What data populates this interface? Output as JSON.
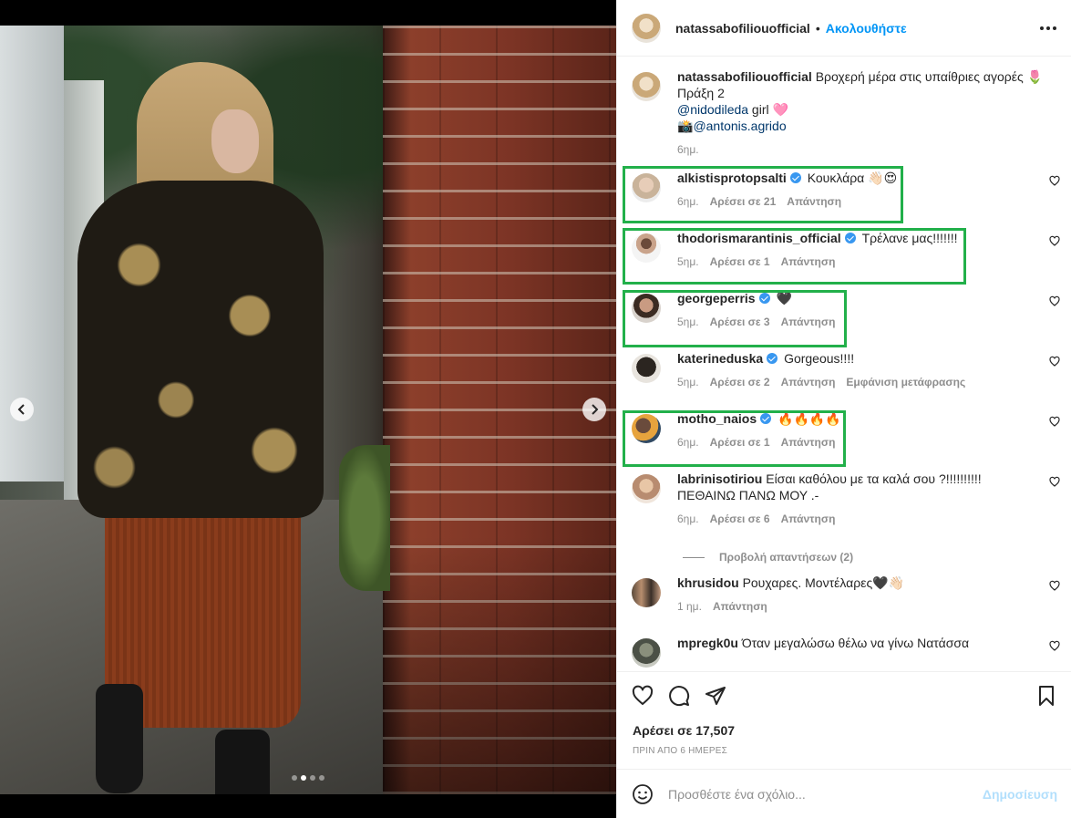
{
  "header": {
    "username": "natassabofiliouofficial",
    "bullet": "•",
    "follow_label": "Ακολουθήστε",
    "more_icon": "more-horizontal-icon"
  },
  "caption": {
    "username": "natassabofiliouofficial",
    "text": "Βροχερή μέρα στις υπαίθριες αγορές 🌷",
    "line2": "Πράξη 2",
    "mention1": "@nidodileda",
    "mention1_suffix": " girl 🩷",
    "mention2_prefix": "📸",
    "mention2": "@antonis.agrido",
    "time": "6ημ."
  },
  "comments": [
    {
      "username": "alkistisprotopsalti",
      "verified": true,
      "text": "Κουκλάρα 👋🏻😍",
      "time": "6ημ.",
      "likes": "Αρέσει σε 21",
      "reply": "Απάντηση",
      "highlighted": true
    },
    {
      "username": "thodorismarantinis_official",
      "verified": true,
      "text": "Τρέλανε μας!!!!!!!",
      "time": "5ημ.",
      "likes": "Αρέσει σε 1",
      "reply": "Απάντηση",
      "highlighted": true
    },
    {
      "username": "georgeperris",
      "verified": true,
      "text": "🖤",
      "time": "5ημ.",
      "likes": "Αρέσει σε 3",
      "reply": "Απάντηση",
      "highlighted": true
    },
    {
      "username": "katerineduska",
      "verified": true,
      "text": "Gorgeous!!!!",
      "time": "5ημ.",
      "likes": "Αρέσει σε 2",
      "reply": "Απάντηση",
      "translate": "Εμφάνιση μετάφρασης",
      "highlighted": false
    },
    {
      "username": "motho_naios",
      "verified": true,
      "text": "🔥🔥🔥🔥",
      "time": "6ημ.",
      "likes": "Αρέσει σε 1",
      "reply": "Απάντηση",
      "highlighted": true
    },
    {
      "username": "labrinisotiriou",
      "verified": false,
      "text": "Είσαι καθόλου με τα καλά σου ?!!!!!!!!!!",
      "text2": "ΠΕΘΑΙΝΩ ΠΑΝΩ ΜΟΥ .-",
      "time": "6ημ.",
      "likes": "Αρέσει σε 6",
      "reply": "Απάντηση",
      "highlighted": false
    },
    {
      "username": "khrusidou",
      "verified": false,
      "text": "Ρουχαρες. Μοντέλαρες🖤👋🏻",
      "time": "1 ημ.",
      "reply": "Απάντηση",
      "highlighted": false
    },
    {
      "username": "mpregk0u",
      "verified": false,
      "text": "Όταν μεγαλώσω θέλω να γίνω Νατάσσα",
      "highlighted": false
    }
  ],
  "view_replies": "Προβολή απαντήσεων (2)",
  "actions": {
    "like_icon": "heart-icon",
    "comment_icon": "comment-icon",
    "share_icon": "send-icon",
    "save_icon": "bookmark-icon",
    "likes_text": "Αρέσει σε 17,507",
    "date_text": "ΠΡΙΝ ΑΠΟ 6 ΗΜΕΡΕΣ"
  },
  "composer": {
    "emoji_icon": "emoji-icon",
    "placeholder": "Προσθέστε ένα σχόλιο...",
    "post_label": "Δημοσίευση"
  },
  "carousel": {
    "slide_count": 4,
    "active_index": 1
  },
  "colors": {
    "accent": "#0095f6",
    "verified": "#3897f0",
    "highlight_box": "#22b04a",
    "muted": "#8e8e8e"
  }
}
